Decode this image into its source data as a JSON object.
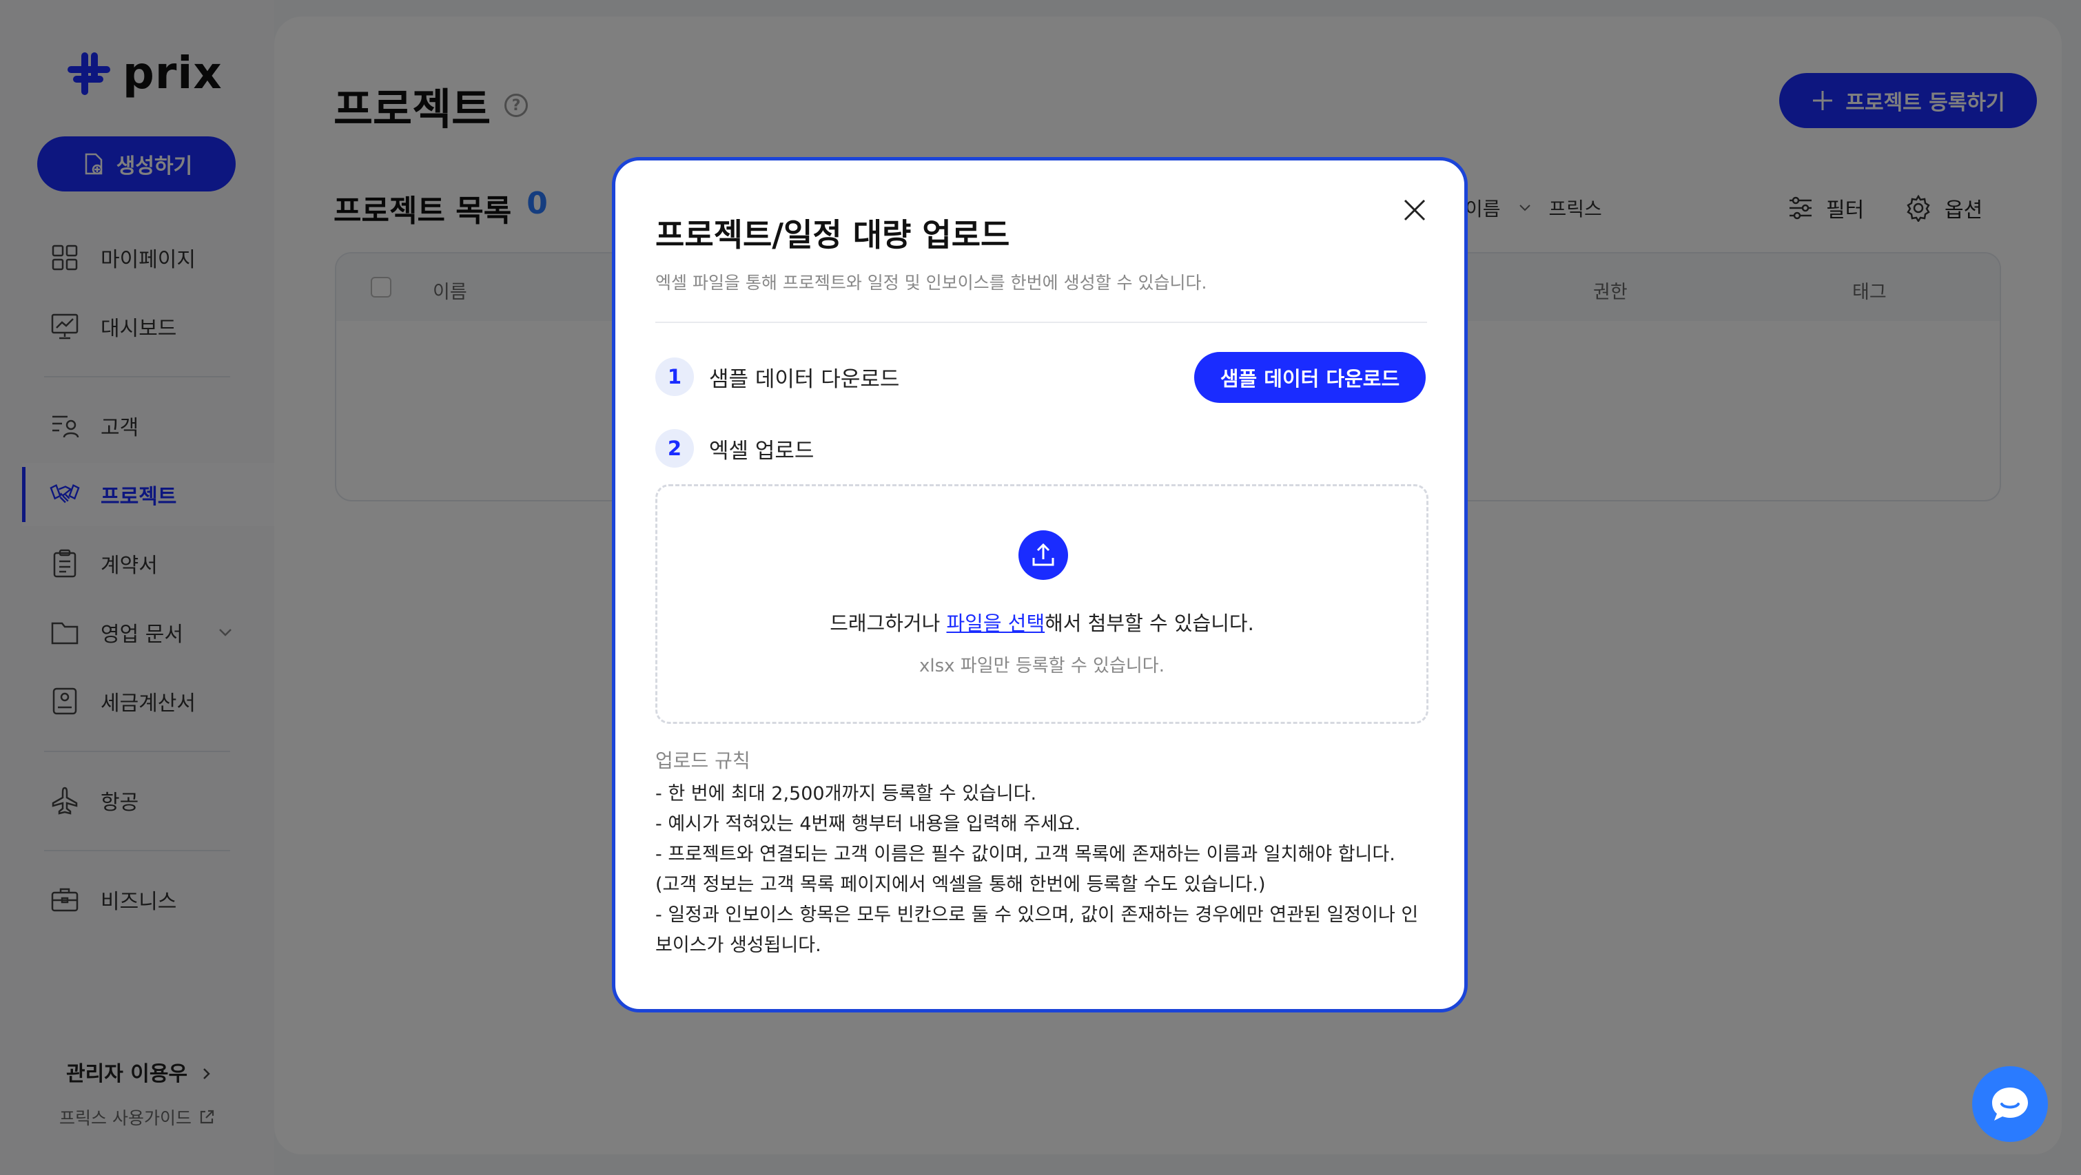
{
  "brand": {
    "name": "prix",
    "accent": "#1a2cff"
  },
  "sidebar": {
    "create_label": "생성하기",
    "items": [
      {
        "label": "마이페이지",
        "icon": "grid-icon"
      },
      {
        "label": "대시보드",
        "icon": "chart-board-icon"
      },
      {
        "label": "고객",
        "icon": "customer-list-icon"
      },
      {
        "label": "프로젝트",
        "icon": "handshake-icon",
        "active": true
      },
      {
        "label": "계약서",
        "icon": "clipboard-icon"
      },
      {
        "label": "영업 문서",
        "icon": "folder-icon"
      },
      {
        "label": "세금계산서",
        "icon": "receipt-icon"
      },
      {
        "label": "항공",
        "icon": "airplane-icon"
      },
      {
        "label": "비즈니스",
        "icon": "briefcase-icon"
      }
    ],
    "admin_label": "관리자 이용우",
    "guide_label": "프릭스 사용가이드"
  },
  "main": {
    "title": "프로젝트",
    "help": "?",
    "register_label": "프로젝트 등록하기",
    "list_title": "프로젝트 목록",
    "list_count": "0",
    "sort_label": "이름",
    "sort_scope": "프릭스",
    "filter_label": "필터",
    "options_label": "옵션",
    "table_headers": {
      "name": "이름",
      "permission": "권한",
      "tag": "태그"
    }
  },
  "modal": {
    "title": "프로젝트/일정 대량 업로드",
    "subtitle": "엑셀 파일을 통해 프로젝트와 일정 및 인보이스를 한번에 생성할 수 있습니다.",
    "step1": {
      "num": "1",
      "label": "샘플 데이터 다운로드",
      "button": "샘플 데이터 다운로드"
    },
    "step2": {
      "num": "2",
      "label": "엑셀 업로드"
    },
    "dropzone": {
      "text_before": "드래그하거나 ",
      "link": "파일을 선택",
      "text_after": "해서 첨부할 수 있습니다.",
      "note": "xlsx 파일만 등록할 수 있습니다."
    },
    "rules_title": "업로드 규칙",
    "rules": [
      "- 한 번에 최대 2,500개까지 등록할 수 있습니다.",
      "- 예시가 적혀있는 4번째 행부터 내용을 입력해 주세요.",
      "- 프로젝트와 연결되는 고객 이름은 필수 값이며, 고객 목록에 존재하는 이름과 일치해야 합니다.",
      "(고객 정보는 고객 목록 페이지에서 엑셀을 통해 한번에 등록할 수도 있습니다.)",
      "- 일정과 인보이스 항목은 모두 빈칸으로 둘 수 있으며, 값이 존재하는 경우에만 연관된 일정이나 인보이스가 생성됩니다."
    ]
  }
}
